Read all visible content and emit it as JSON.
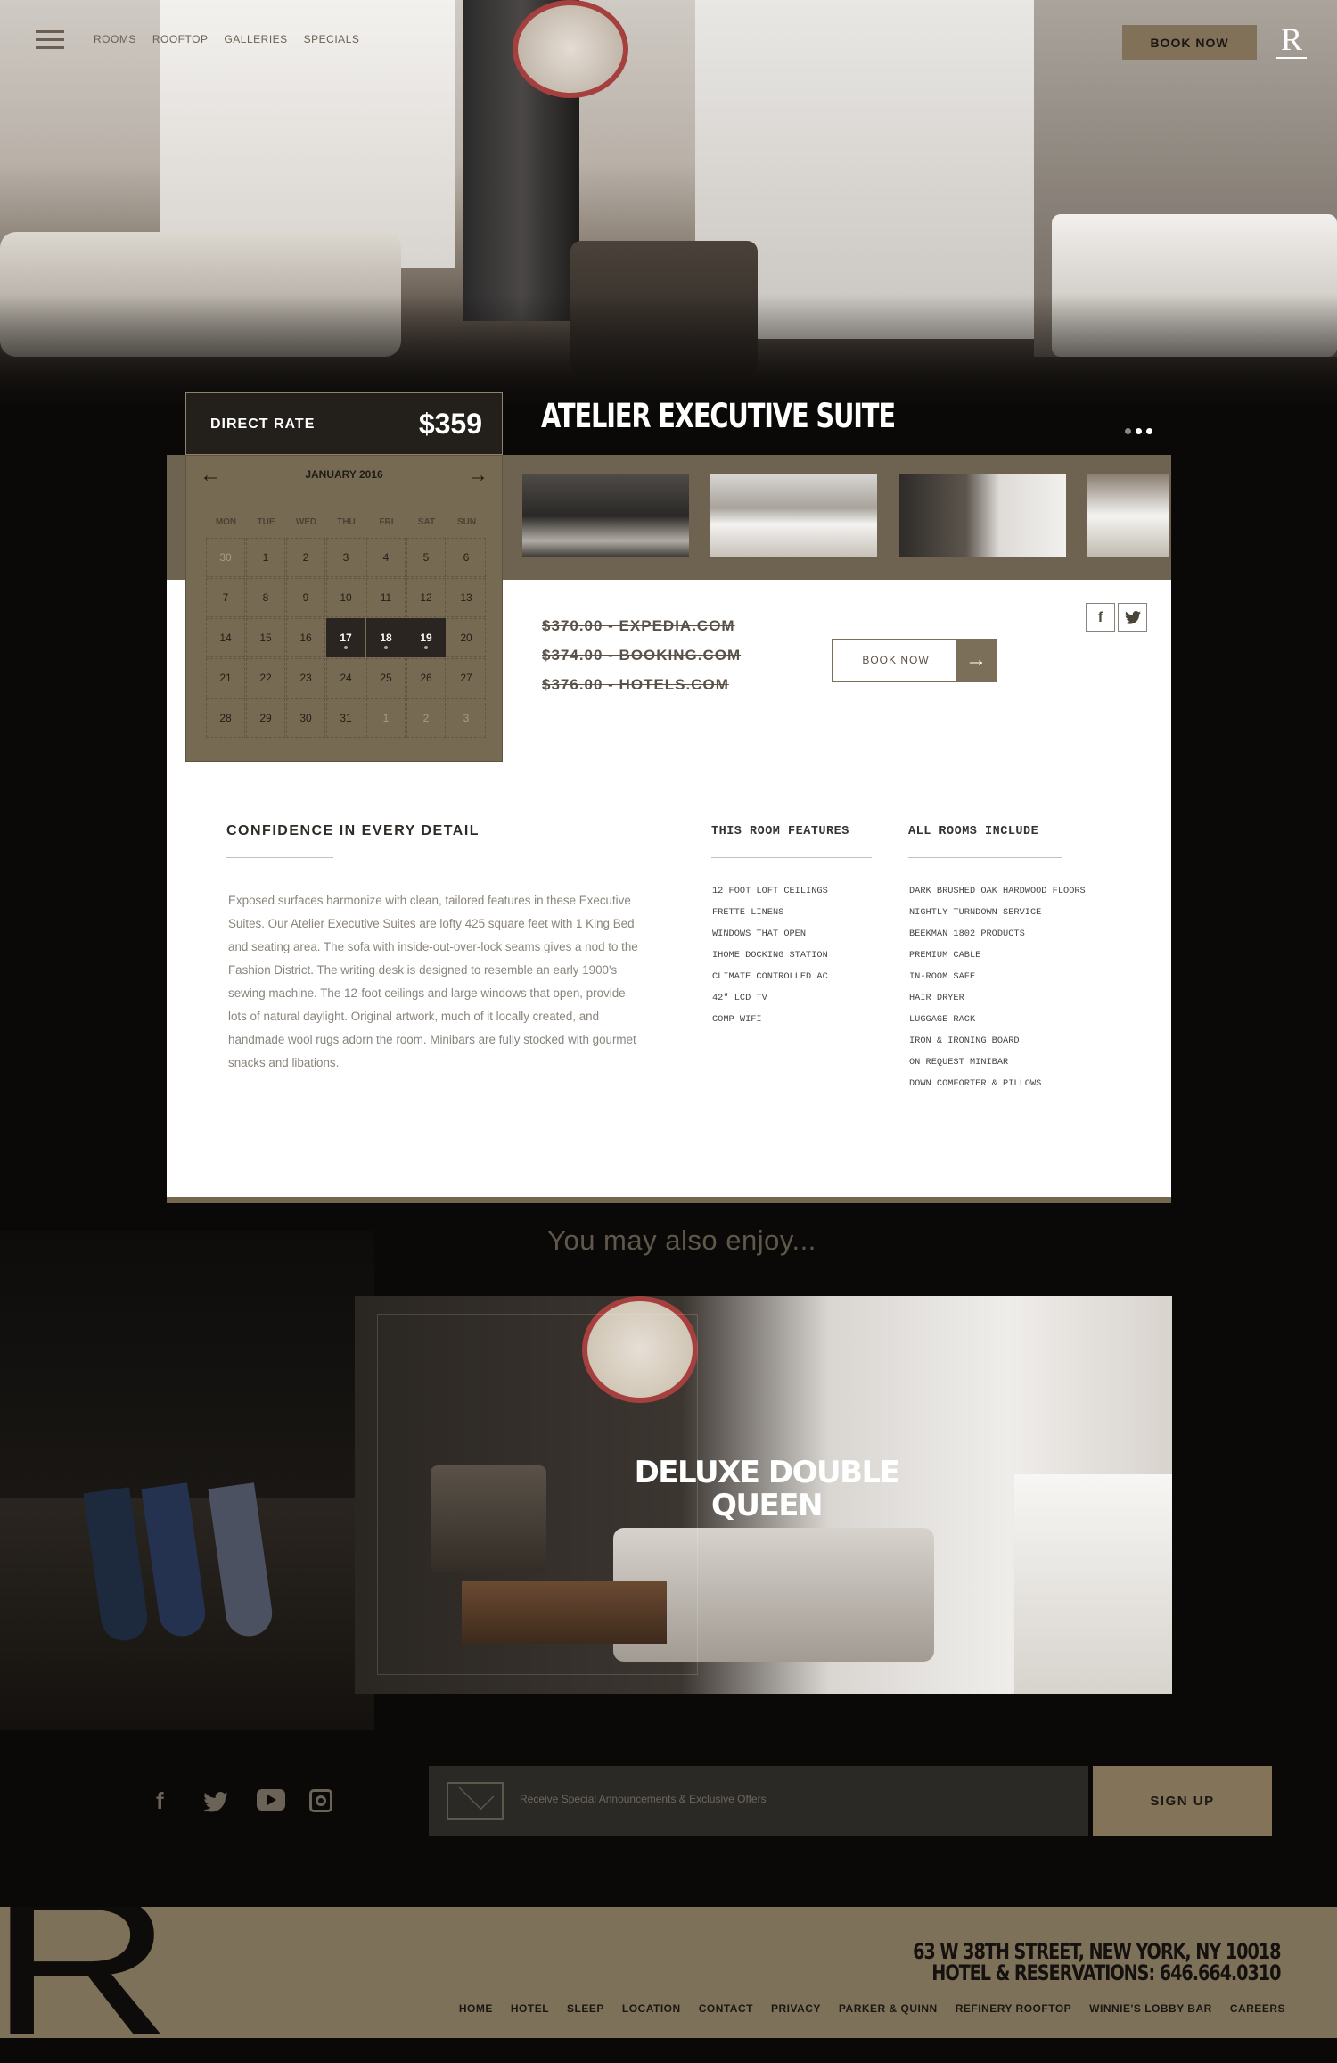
{
  "nav": {
    "links": [
      "ROOMS",
      "ROOFTOP",
      "GALLERIES",
      "SPECIALS"
    ],
    "book_now": "BOOK NOW",
    "logo": "R"
  },
  "hero": {
    "title": "ATELIER EXECUTIVE SUITE",
    "slide_count": 3,
    "active_slide": 1
  },
  "rate": {
    "label": "DIRECT RATE",
    "price": "$359"
  },
  "calendar": {
    "month": "JANUARY 2016",
    "days_of_week": [
      "MON",
      "TUE",
      "WED",
      "THU",
      "FRI",
      "SAT",
      "SUN"
    ],
    "weeks": [
      [
        "30",
        "1",
        "2",
        "3",
        "4",
        "5",
        "6"
      ],
      [
        "7",
        "8",
        "9",
        "10",
        "11",
        "12",
        "13"
      ],
      [
        "14",
        "15",
        "16",
        "17",
        "18",
        "19",
        "20"
      ],
      [
        "21",
        "22",
        "23",
        "24",
        "25",
        "26",
        "27"
      ],
      [
        "28",
        "29",
        "30",
        "31",
        "1",
        "2",
        "3"
      ]
    ],
    "muted": [
      [
        0,
        0
      ],
      [
        4,
        4
      ],
      [
        4,
        5
      ],
      [
        4,
        6
      ]
    ],
    "selected": [
      [
        2,
        3
      ],
      [
        2,
        4
      ],
      [
        2,
        5
      ]
    ]
  },
  "competitor_prices": [
    "$370.00 - EXPEDIA.COM",
    "$374.00 - BOOKING.COM",
    "$376.00 - HOTELS.COM"
  ],
  "book_now_button": "BOOK NOW",
  "share": [
    "f",
    "t"
  ],
  "details": {
    "heading": "CONFIDENCE IN EVERY DETAIL",
    "body": "Exposed surfaces harmonize with clean, tailored features in these Executive Suites. Our Atelier Executive Suites are lofty 425 square feet with 1 King Bed and seating area. The sofa with inside-out-over-lock seams gives a nod to the Fashion District. The writing desk is designed to resemble an early 1900's sewing machine. The 12-foot ceilings and large windows that open, provide lots of natural daylight. Original artwork, much of it locally created, and handmade wool rugs adorn the room. Minibars are fully stocked with gourmet snacks and libations."
  },
  "room_features": {
    "heading": "THIS ROOM FEATURES",
    "items": [
      "12 FOOT LOFT CEILINGS",
      "FRETTE LINENS",
      "WINDOWS THAT OPEN",
      "IHOME DOCKING STATION",
      "CLIMATE CONTROLLED AC",
      "42\" LCD TV",
      "COMP  WIFI"
    ]
  },
  "all_rooms": {
    "heading": "ALL ROOMS INCLUDE",
    "items": [
      "DARK BRUSHED OAK HARDWOOD FLOORS",
      "NIGHTLY TURNDOWN SERVICE",
      "BEEKMAN 1802 PRODUCTS",
      "PREMIUM CABLE",
      "IN-ROOM SAFE",
      "HAIR DRYER",
      "LUGGAGE RACK",
      "IRON & IRONING BOARD",
      "ON REQUEST MINIBAR",
      "DOWN COMFORTER & PILLOWS"
    ]
  },
  "enjoy": {
    "heading": "You may also enjoy...",
    "featured_title_line1": "DELUXE DOUBLE",
    "featured_title_line2": "QUEEN"
  },
  "newsletter": {
    "placeholder": "Receive Special Announcements & Exclusive Offers",
    "button": "SIGN UP"
  },
  "footer": {
    "logo": "R",
    "address": "63 W 38TH STREET, NEW YORK, NY 10018",
    "phone": "HOTEL & RESERVATIONS: 646.664.0310",
    "links": [
      "HOME",
      "HOTEL",
      "SLEEP",
      "LOCATION",
      "CONTACT",
      "PRIVACY",
      "PARKER & QUINN",
      "REFINERY ROOFTOP",
      "WINNIE'S LOBBY BAR",
      "CAREERS"
    ]
  },
  "colors": {
    "accent": "#807158",
    "dark": "#0a0908",
    "card": "#ffffff"
  }
}
